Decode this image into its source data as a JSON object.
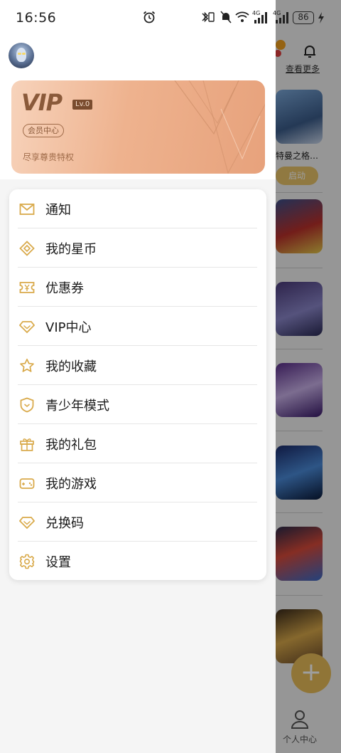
{
  "status_bar": {
    "time": "16:56",
    "battery": "86",
    "signal_label_1": "4G",
    "signal_label_2": "4G"
  },
  "drawer": {
    "vip_card": {
      "logo": "VIP",
      "level": "Lv.0",
      "member_center": "会员中心",
      "privilege_text": "尽享尊贵特权"
    },
    "menu": [
      {
        "label": "通知",
        "icon": "mail-icon"
      },
      {
        "label": "我的星币",
        "icon": "coin-icon"
      },
      {
        "label": "优惠券",
        "icon": "coupon-icon"
      },
      {
        "label": "VIP中心",
        "icon": "diamond-icon"
      },
      {
        "label": "我的收藏",
        "icon": "star-icon"
      },
      {
        "label": "青少年模式",
        "icon": "shield-icon"
      },
      {
        "label": "我的礼包",
        "icon": "gift-icon"
      },
      {
        "label": "我的游戏",
        "icon": "gamepad-icon"
      },
      {
        "label": "兑换码",
        "icon": "diamond-icon"
      },
      {
        "label": "设置",
        "icon": "gear-icon"
      }
    ]
  },
  "background_app": {
    "see_more": "查看更多",
    "game_title": "特曼之格…",
    "launch_button": "启动",
    "fab_symbol": "+",
    "tab_profile": "个人中心"
  },
  "colors": {
    "accent_gold": "#d9aa4b",
    "vip_card": "#eeb28e"
  }
}
